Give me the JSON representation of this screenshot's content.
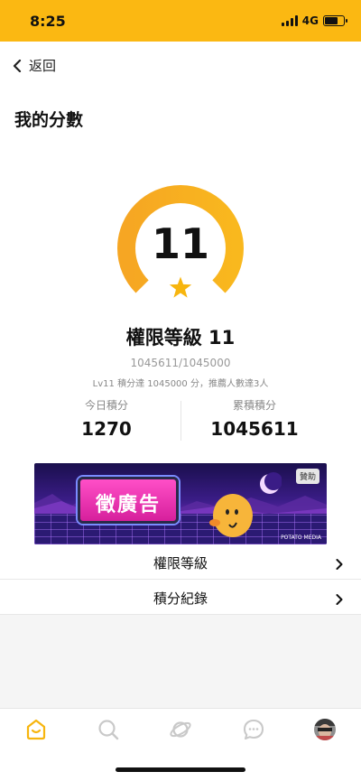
{
  "status_bar": {
    "time": "8:25",
    "network": "4G",
    "battery_level": 0.8,
    "background": "#fbb812"
  },
  "nav": {
    "back_label": "返回",
    "back_icon": "chevron-left-icon"
  },
  "page": {
    "title": "我的分數"
  },
  "level": {
    "number": "11",
    "title": "權限等級 11",
    "score_fraction": "1045611/1045000",
    "description": "Lv11 積分達 1045000 分，推薦人數達3人",
    "progress": 1.0,
    "gauge_color_start": "#f6a623",
    "gauge_color_end": "#f9b81e",
    "star_color": "#f7b50e"
  },
  "stats": {
    "today_label": "今日積分",
    "today_value": "1270",
    "total_label": "累積積分",
    "total_value": "1045611"
  },
  "ad": {
    "label": "徵廣告",
    "sponsor_badge": "贊助",
    "brand": "POTATO MEDIA"
  },
  "menu": {
    "items": [
      {
        "label": "權限等級",
        "icon": "chevron-right-icon"
      },
      {
        "label": "積分紀錄",
        "icon": "chevron-right-icon"
      }
    ]
  },
  "tab_bar": {
    "active_color": "#f7b50e",
    "inactive_color": "#c9c9c9",
    "tabs": [
      {
        "icon": "home-icon",
        "active": true
      },
      {
        "icon": "search-icon",
        "active": false
      },
      {
        "icon": "planet-icon",
        "active": false
      },
      {
        "icon": "chat-icon",
        "active": false
      },
      {
        "icon": "avatar",
        "active": false
      }
    ]
  }
}
